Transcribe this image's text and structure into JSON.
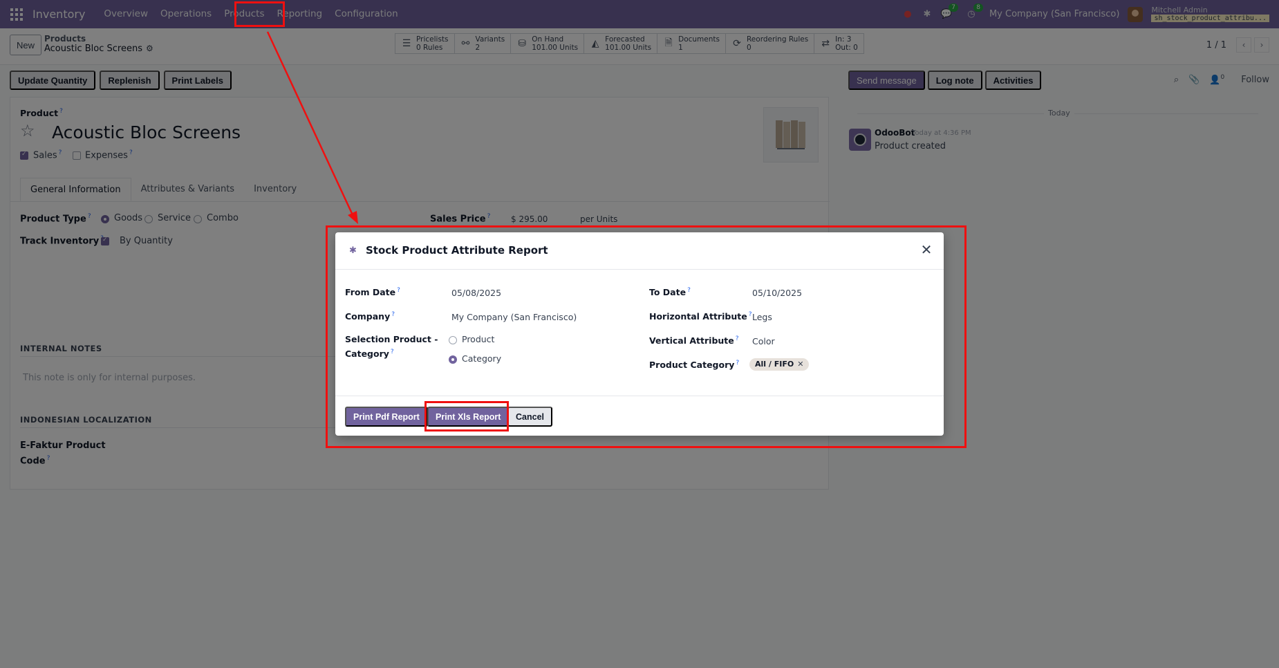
{
  "navbar": {
    "brand": "Inventory",
    "menu": [
      "Overview",
      "Operations",
      "Products",
      "Reporting",
      "Configuration"
    ],
    "badges": {
      "chat": "7",
      "activity": "8"
    },
    "company": "My Company (San Francisco)",
    "user_name": "Mitchell Admin",
    "database": "sh_stock_product_attribu..."
  },
  "control_panel": {
    "new_label": "New",
    "breadcrumb_parent": "Products",
    "breadcrumb_current": "Acoustic Bloc Screens",
    "smart_buttons": [
      {
        "icon": "list-icon",
        "glyph": "☰",
        "line1": "Pricelists",
        "line2": "0 Rules"
      },
      {
        "icon": "sitemap-icon",
        "glyph": "⚯",
        "line1": "Variants",
        "line2": "2"
      },
      {
        "icon": "cubes-icon",
        "glyph": "⛁",
        "line1": "On Hand",
        "line2": "101.00 Units"
      },
      {
        "icon": "area-chart-icon",
        "glyph": "◭",
        "line1": "Forecasted",
        "line2": "101.00 Units"
      },
      {
        "icon": "document-icon",
        "glyph": "🗎",
        "line1": "Documents",
        "line2": "1"
      },
      {
        "icon": "refresh-icon",
        "glyph": "⟳",
        "line1": "Reordering Rules",
        "line2": "0"
      },
      {
        "icon": "exchange-icon",
        "glyph": "⇄",
        "line1": "In: 3",
        "line2": "Out: 0"
      }
    ],
    "pager": "1 / 1"
  },
  "actions": [
    "Update Quantity",
    "Replenish",
    "Print Labels"
  ],
  "form": {
    "product_label": "Product",
    "product_name": "Acoustic Bloc Screens",
    "sales_label": "Sales",
    "expenses_label": "Expenses",
    "tabs": [
      "General Information",
      "Attributes & Variants",
      "Inventory"
    ],
    "product_type_label": "Product Type",
    "product_type_options": [
      "Goods",
      "Service",
      "Combo"
    ],
    "track_inventory_label": "Track Inventory",
    "track_inventory_value": "By Quantity",
    "sales_price_label": "Sales Price",
    "sales_price_value": "$ 295.00",
    "sales_price_unit": "per  Units",
    "internal_notes_title": "INTERNAL NOTES",
    "internal_notes_placeholder": "This note is only for internal purposes.",
    "indonesian_title": "INDONESIAN LOCALIZATION",
    "efaktur_label_1": "E-Faktur Product",
    "efaktur_label_2": "Code"
  },
  "chatter": {
    "send_message": "Send message",
    "log_note": "Log note",
    "activities": "Activities",
    "follower_count": "0",
    "follow": "Follow",
    "today": "Today",
    "author": "OdooBot",
    "time": "Today at 4:36 PM",
    "body": "Product created"
  },
  "dialog": {
    "title": "Stock Product Attribute Report",
    "from_date_label": "From Date",
    "from_date_value": "05/08/2025",
    "to_date_label": "To Date",
    "to_date_value": "05/10/2025",
    "company_label": "Company",
    "company_value": "My Company (San Francisco)",
    "horizontal_label": "Horizontal Attribute",
    "horizontal_value": "Legs",
    "selection_label_1": "Selection Product -",
    "selection_label_2": "Category",
    "selection_option_product": "Product",
    "selection_option_category": "Category",
    "vertical_label": "Vertical Attribute",
    "vertical_value": "Color",
    "category_label": "Product Category",
    "category_tag": "All / FIFO",
    "print_pdf": "Print Pdf Report",
    "print_xls": "Print Xls Report",
    "cancel": "Cancel"
  },
  "colors": {
    "brand": "#71639e",
    "highlight": "#ef1010"
  }
}
